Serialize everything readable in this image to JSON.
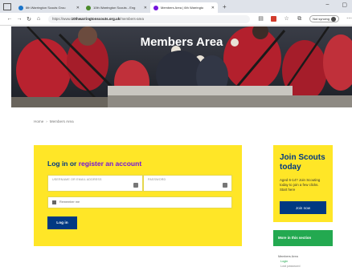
{
  "browser": {
    "tabs": [
      {
        "title": "6th Warrington Scouts Grou",
        "active": false
      },
      {
        "title": "10th Warrington Scouts - Eng",
        "active": false
      },
      {
        "title": "Members Area | 6th Warringto",
        "active": true
      }
    ],
    "new_tab": "+",
    "url_prefix": "https://www.",
    "url_host": "10thwarringtonscouts.org.uk",
    "url_path": "/members-area",
    "signin": "Not syncing"
  },
  "hero": {
    "title": "Members Area"
  },
  "breadcrumb": {
    "home": "Home",
    "separator": "›",
    "current": "Members Area"
  },
  "login": {
    "title_prefix": "Log in or",
    "title_link": "register an account",
    "username_label": "Username or email address",
    "password_label": "Password",
    "remember_label": "Remember me",
    "button": "Log in"
  },
  "join": {
    "title": "Join Scouts today",
    "text": "Aged 6-14? Join Scouting today to join a few clicks. Start here",
    "button": "Join now"
  },
  "section": {
    "heading": "More in this section",
    "items": [
      {
        "label": "Members Area",
        "level": 0
      },
      {
        "label": "Login",
        "level": 1
      },
      {
        "label": "Lost password",
        "level": 2
      }
    ]
  }
}
